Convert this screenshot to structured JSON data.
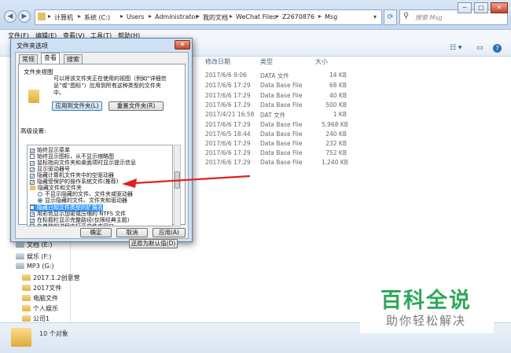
{
  "window": {
    "title_buttons": [
      "─",
      "□",
      "✕"
    ],
    "breadcrumb": [
      "计算机",
      "系统 (C:)",
      "Users",
      "Administrator",
      "我的文档",
      "WeChat Files",
      "Z2670876",
      "Msg"
    ],
    "search_placeholder": "搜索 Msg",
    "menu": [
      "文件(F)",
      "编辑(E)",
      "查看(V)",
      "工具(T)",
      "帮助(H)"
    ],
    "columns": {
      "modified": "修改日期",
      "type": "类型",
      "size": "大小"
    }
  },
  "files": [
    {
      "date": "2017/6/6 9:06",
      "type": "DATA 文件",
      "size": "14 KB"
    },
    {
      "date": "2017/6/6 17:29",
      "type": "Data Base File",
      "size": "68 KB"
    },
    {
      "date": "2017/6/6 17:29",
      "type": "Data Base File",
      "size": "40 KB"
    },
    {
      "date": "2017/6/6 17:29",
      "type": "Data Base File",
      "size": "500 KB"
    },
    {
      "date": "2017/4/21 16:58",
      "type": "DAT 文件",
      "size": "1 KB"
    },
    {
      "date": "2017/6/6 17:29",
      "type": "Data Base File",
      "size": "5,968 KB"
    },
    {
      "date": "2017/6/5 18:44",
      "type": "Data Base File",
      "size": "240 KB"
    },
    {
      "date": "2017/6/6 17:29",
      "type": "Data Base File",
      "size": "232 KB"
    },
    {
      "date": "2017/6/6 17:29",
      "type": "Data Base File",
      "size": "752 KB"
    },
    {
      "date": "2017/6/6 17:29",
      "type": "Data Base File",
      "size": "1,240 KB"
    }
  ],
  "nav": {
    "drives": [
      "文档 (E:)",
      "娱乐 (F:)",
      "MP3 (G:)"
    ],
    "folders": [
      "2017.1.2创意营",
      "2017文件",
      "电脑文件",
      "个人娱乐",
      "公司1"
    ]
  },
  "status": {
    "count": "10 个对象"
  },
  "dialog": {
    "title": "文件夹选项",
    "close": "✕",
    "tabs": [
      "常规",
      "查看",
      "搜索"
    ],
    "folder_view": {
      "heading": "文件夹视图",
      "desc_line1": "可以将该文件夹正在使用的视图（例如“详细信",
      "desc_line2": "息”或“图标”）应用到所有这种类型的文件夹",
      "desc_line3": "中。",
      "apply_btn": "应用到文件夹(L)",
      "reset_btn": "重置文件夹(R)"
    },
    "advanced_heading": "高级设置:",
    "settings": [
      {
        "label": "始终显示菜单",
        "kind": "check",
        "checked": true
      },
      {
        "label": "始终显示图标，从不显示缩略图",
        "kind": "check",
        "checked": false
      },
      {
        "label": "鼠标指向文件夹和桌面项时显示提示信息",
        "kind": "check",
        "checked": true
      },
      {
        "label": "显示驱动器号",
        "kind": "check",
        "checked": true
      },
      {
        "label": "隐藏计算机文件夹中的空驱动器",
        "kind": "check",
        "checked": true
      },
      {
        "label": "隐藏受保护的操作系统文件(推荐)",
        "kind": "check",
        "checked": true
      },
      {
        "label": "隐藏文件和文件夹",
        "kind": "folder"
      },
      {
        "label": "不显示隐藏的文件、文件夹或驱动器",
        "kind": "radio",
        "checked": false
      },
      {
        "label": "显示隐藏的文件、文件夹和驱动器",
        "kind": "radio",
        "checked": true
      },
      {
        "label": "隐藏已知文件类型的扩展名",
        "kind": "check",
        "checked": false
      },
      {
        "label": "用彩色显示加密或压缩的 NTFS 文件",
        "kind": "check",
        "checked": true
      },
      {
        "label": "在标题栏显示完整路径(仅限经典主题)",
        "kind": "check",
        "checked": true
      },
      {
        "label": "在单独的进程中打开文件夹窗口",
        "kind": "check",
        "checked": false
      }
    ],
    "restore_btn": "还原为默认值(D)",
    "ok": "确定",
    "cancel": "取消",
    "apply": "应用(A)"
  },
  "watermark": {
    "line1": "百科全说",
    "line2": "助你轻松解决"
  },
  "colors": {
    "arrow": "#e02020",
    "highlight": "#3399ff",
    "watermark_green": "#2fa85c"
  }
}
